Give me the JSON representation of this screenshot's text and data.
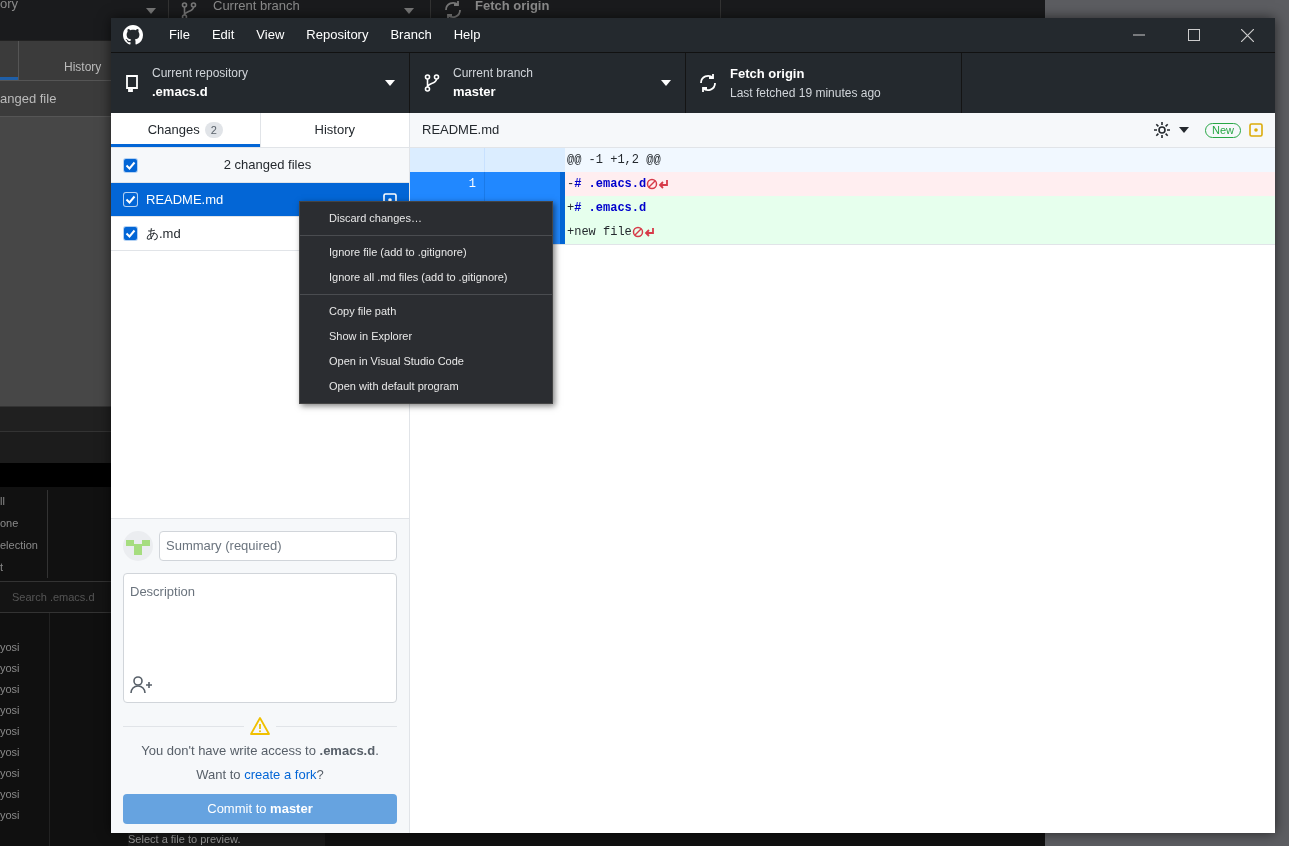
{
  "back_window": {
    "repository_caption": "ory",
    "branch_caption": "Current branch",
    "fetch_caption": "Fetch origin",
    "tab": "History",
    "changed_files": "anged file",
    "menu_items": [
      "ll",
      "one",
      "election",
      "t"
    ],
    "search": {
      "placeholder": "Search .emacs.d"
    },
    "authors": [
      "yosi",
      "yosi",
      "yosi",
      "yosi",
      "yosi",
      "yosi",
      "yosi",
      "yosi",
      "yosi"
    ],
    "status": "Select a file to preview."
  },
  "menu": [
    "File",
    "Edit",
    "View",
    "Repository",
    "Branch",
    "Help"
  ],
  "toolbar": {
    "repository": {
      "label": "Current repository",
      "value": ".emacs.d"
    },
    "branch": {
      "label": "Current branch",
      "value": "master"
    },
    "fetch": {
      "label": "Fetch origin",
      "value": "Last fetched 19 minutes ago"
    }
  },
  "tabs": [
    {
      "label": "Changes",
      "count": "2",
      "selected": true
    },
    {
      "label": "History",
      "selected": false
    }
  ],
  "select_all": {
    "label": "2 changed files",
    "checked": true
  },
  "files": [
    {
      "name": "README.md",
      "checked": true,
      "selected": true,
      "modified": true
    },
    {
      "name": "あ.md",
      "checked": true,
      "selected": false
    }
  ],
  "context_menu": [
    [
      "Discard changes…"
    ],
    [
      "Ignore file (add to .gitignore)",
      "Ignore all .md files (add to .gitignore)"
    ],
    [
      "Copy file path",
      "Show in Explorer",
      "Open in Visual Studio Code",
      "Open with default program"
    ]
  ],
  "diff": {
    "file": "README.md",
    "badge": "New",
    "hunk_header": "@@ -1 +1,2 @@",
    "lines": [
      {
        "kind": "deleted",
        "old_number": "1",
        "prefix": "-",
        "text": "# .emacs.d",
        "heading": true,
        "no_newline": true,
        "selected": true
      },
      {
        "kind": "added",
        "prefix": "+",
        "text": "# .emacs.d",
        "heading": true,
        "no_newline": false,
        "selected": true
      },
      {
        "kind": "added",
        "prefix": "+",
        "text": "new file",
        "heading": false,
        "no_newline": true,
        "selected": true
      }
    ]
  },
  "commit": {
    "summary": {
      "placeholder": "Summary (required)"
    },
    "description": {
      "placeholder": "Description"
    },
    "notice": "You don't have write access to **.emacs.d**.",
    "fork_prefix": "Want to ",
    "fork_link": "create a fork",
    "fork_suffix": "?",
    "button": "Commit to **master**",
    "disabled": true
  }
}
